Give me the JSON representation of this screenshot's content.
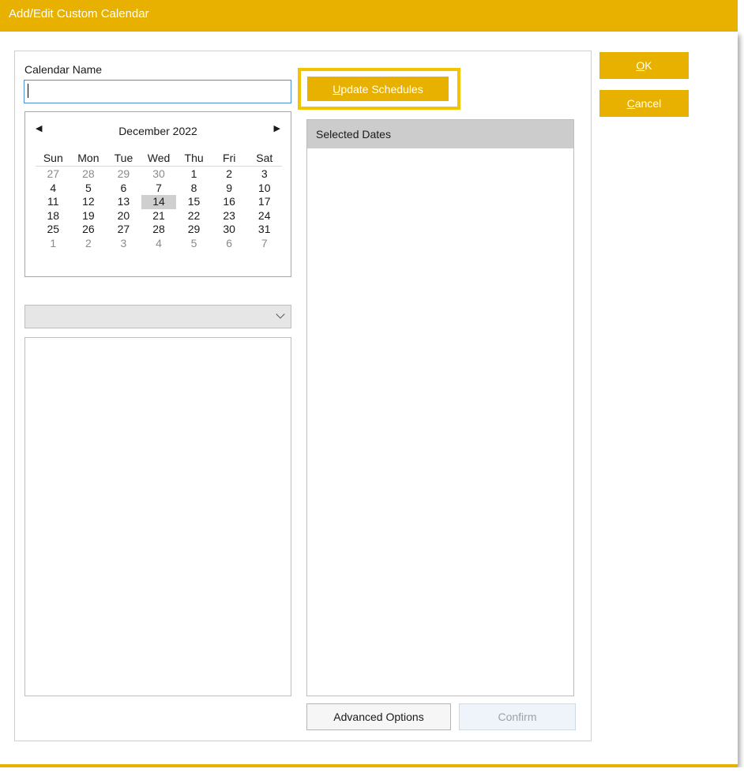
{
  "window": {
    "title": "Add/Edit Custom Calendar"
  },
  "calendar_name": {
    "label": "Calendar Name",
    "value": ""
  },
  "month_calendar": {
    "month_label": "December 2022",
    "prev_glyph": "◀",
    "next_glyph": "▶",
    "weekdays": [
      "Sun",
      "Mon",
      "Tue",
      "Wed",
      "Thu",
      "Fri",
      "Sat"
    ],
    "days": [
      {
        "d": "27",
        "other": true
      },
      {
        "d": "28",
        "other": true
      },
      {
        "d": "29",
        "other": true
      },
      {
        "d": "30",
        "other": true
      },
      {
        "d": "1"
      },
      {
        "d": "2"
      },
      {
        "d": "3"
      },
      {
        "d": "4"
      },
      {
        "d": "5"
      },
      {
        "d": "6"
      },
      {
        "d": "7"
      },
      {
        "d": "8"
      },
      {
        "d": "9"
      },
      {
        "d": "10"
      },
      {
        "d": "11"
      },
      {
        "d": "12"
      },
      {
        "d": "13"
      },
      {
        "d": "14",
        "today": true
      },
      {
        "d": "15"
      },
      {
        "d": "16"
      },
      {
        "d": "17"
      },
      {
        "d": "18"
      },
      {
        "d": "19"
      },
      {
        "d": "20"
      },
      {
        "d": "21"
      },
      {
        "d": "22"
      },
      {
        "d": "23"
      },
      {
        "d": "24"
      },
      {
        "d": "25"
      },
      {
        "d": "26"
      },
      {
        "d": "27"
      },
      {
        "d": "28"
      },
      {
        "d": "29"
      },
      {
        "d": "30"
      },
      {
        "d": "31"
      },
      {
        "d": "1",
        "other": true
      },
      {
        "d": "2",
        "other": true
      },
      {
        "d": "3",
        "other": true
      },
      {
        "d": "4",
        "other": true
      },
      {
        "d": "5",
        "other": true
      },
      {
        "d": "6",
        "other": true
      },
      {
        "d": "7",
        "other": true
      }
    ]
  },
  "buttons": {
    "update_schedules_mnemonic": "U",
    "update_schedules_rest": "pdate Schedules",
    "ok_mnemonic": "O",
    "ok_rest": "K",
    "cancel_mnemonic": "C",
    "cancel_rest": "ancel",
    "advanced_options": "Advanced Options",
    "confirm": "Confirm"
  },
  "selected_dates": {
    "header": "Selected Dates",
    "items": []
  },
  "colors": {
    "accent": "#e8b100",
    "highlight_frame": "#f2c400",
    "focus_border": "#4a90d9"
  }
}
